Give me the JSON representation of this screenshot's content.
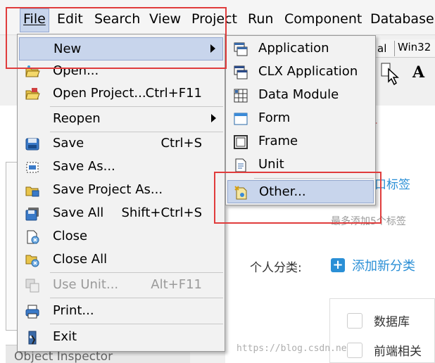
{
  "menubar": {
    "items": [
      {
        "label": "File",
        "mnemonic": "F"
      },
      {
        "label": "Edit",
        "mnemonic": "E"
      },
      {
        "label": "Search",
        "mnemonic": "S"
      },
      {
        "label": "View",
        "mnemonic": "V"
      },
      {
        "label": "Project",
        "mnemonic": "j"
      },
      {
        "label": "Run",
        "mnemonic": "R"
      },
      {
        "label": "Component",
        "mnemonic": "C"
      },
      {
        "label": "Database",
        "mnemonic": "D"
      }
    ]
  },
  "file_menu": {
    "items": [
      {
        "label": "New",
        "icon": "new-icon",
        "submenu": true,
        "highlighted": true
      },
      {
        "label": "Open...",
        "icon": "open-folder-icon"
      },
      {
        "label": "Open Project...",
        "shortcut": "Ctrl+F11",
        "icon": "open-project-icon"
      },
      {
        "label": "Reopen",
        "submenu": true
      },
      {
        "label": "Save",
        "shortcut": "Ctrl+S",
        "icon": "save-icon"
      },
      {
        "label": "Save As...",
        "icon": "save-as-icon"
      },
      {
        "label": "Save Project As...",
        "icon": "save-project-as-icon"
      },
      {
        "label": "Save All",
        "shortcut": "Shift+Ctrl+S",
        "icon": "save-all-icon"
      },
      {
        "label": "Close",
        "icon": "close-file-icon"
      },
      {
        "label": "Close All",
        "icon": "close-all-icon"
      },
      {
        "label": "Use Unit...",
        "shortcut": "Alt+F11",
        "icon": "use-unit-icon",
        "disabled": true
      },
      {
        "label": "Print...",
        "icon": "printer-icon"
      },
      {
        "label": "Exit",
        "icon": "exit-icon"
      }
    ]
  },
  "new_submenu": {
    "items": [
      {
        "label": "Application",
        "icon": "application-icon"
      },
      {
        "label": "CLX Application",
        "icon": "clx-application-icon"
      },
      {
        "label": "Data Module",
        "icon": "data-module-icon"
      },
      {
        "label": "Form",
        "icon": "form-icon"
      },
      {
        "label": "Frame",
        "icon": "frame-icon"
      },
      {
        "label": "Unit",
        "icon": "unit-icon"
      },
      {
        "label": "Other...",
        "icon": "other-icon",
        "highlighted": true
      }
    ]
  },
  "background": {
    "palette_tab_1": "al",
    "palette_tab_2": "Win32",
    "text_tool": "A",
    "object_inspector": "Object Inspector",
    "tag_link": "口标签",
    "tag_hint": "最多添加5个标签",
    "category_label": "个人分类:",
    "add_category": "添加新分类",
    "categories": [
      "数据库",
      "前端相关"
    ],
    "watermark": "https://blog.csdn.ne"
  },
  "colors": {
    "highlight": "#c8d5ec",
    "annotation_red": "#e03c3c",
    "link_blue": "#2a8fd6"
  }
}
